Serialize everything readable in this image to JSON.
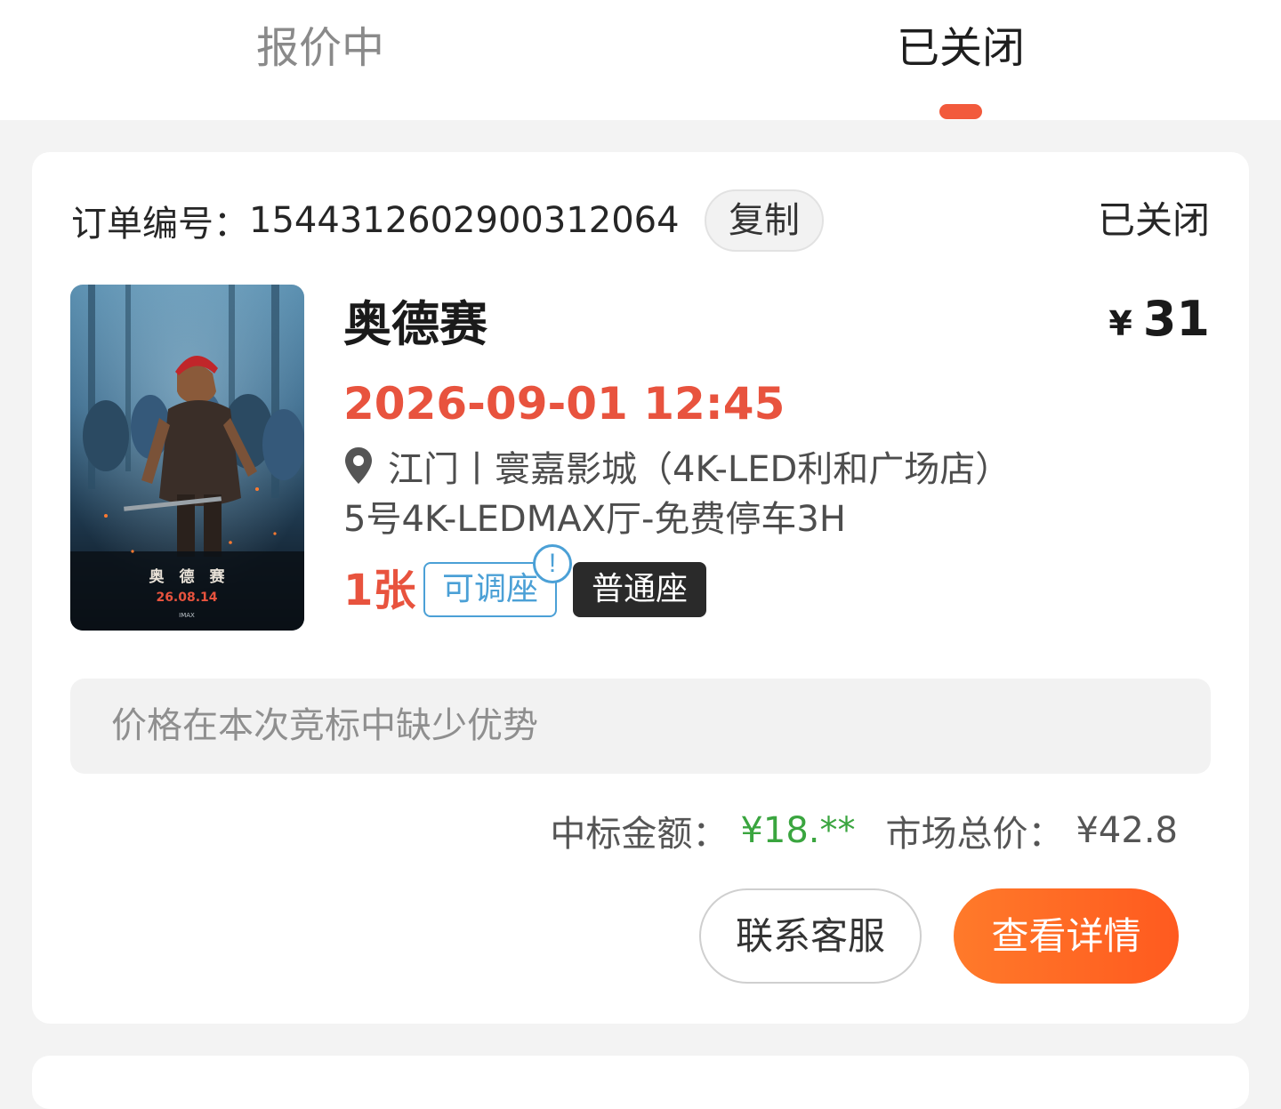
{
  "tabs": [
    {
      "label": "报价中",
      "active": false
    },
    {
      "label": "已关闭",
      "active": true
    }
  ],
  "colors": {
    "accent": "#ff5a1f",
    "price_red": "#e8533e",
    "win_green": "#3aa53f",
    "tag_blue": "#4ba0d6",
    "tab_indicator": "#f25a3c"
  },
  "order": {
    "number_label": "订单编号：",
    "number": "1544312602900312064",
    "copy_label": "复制",
    "status": "已关闭",
    "movie": {
      "title": "奥德赛",
      "poster_title": "奥　德　赛",
      "poster_date": "26.08.14",
      "poster_brand": "IMAX",
      "price_currency": "¥",
      "price": "31",
      "showtime": "2026-09-01 12:45",
      "location_icon": "location-pin-icon",
      "cinema": "江门丨寰嘉影城（4K-LED利和广场店）",
      "hall": "5号4K-LEDMAX厅-免费停车3H",
      "ticket_count": "1张",
      "tag_adjustable": "可调座",
      "tag_info_icon": "exclamation-icon",
      "tag_info_glyph": "!",
      "tag_seat_type": "普通座"
    },
    "reason": "价格在本次竞标中缺少优势",
    "winning_amount_label": "中标金额：",
    "winning_amount": "¥18.**",
    "market_total_label": "市场总价：",
    "market_total": "¥42.8",
    "buttons": {
      "service": "联系客服",
      "detail": "查看详情"
    }
  }
}
